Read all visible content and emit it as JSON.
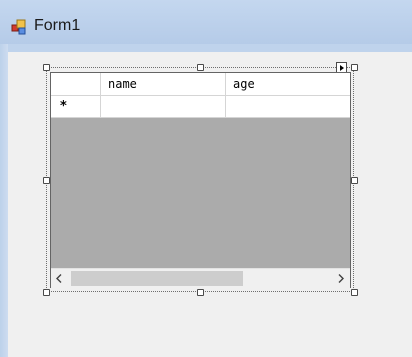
{
  "window": {
    "title": "Form1",
    "icon": "form-icon"
  },
  "grid": {
    "columns": [
      "name",
      "age"
    ],
    "new_row_marker": "*",
    "row_header_selected": false
  },
  "scrollbar": {
    "left_arrow": "scroll-left-arrow-icon",
    "right_arrow": "scroll-right-arrow-icon"
  },
  "colors": {
    "title_bar": "#c4d7ef",
    "grid_background": "#ababab",
    "client_area": "#f0f0f0"
  }
}
